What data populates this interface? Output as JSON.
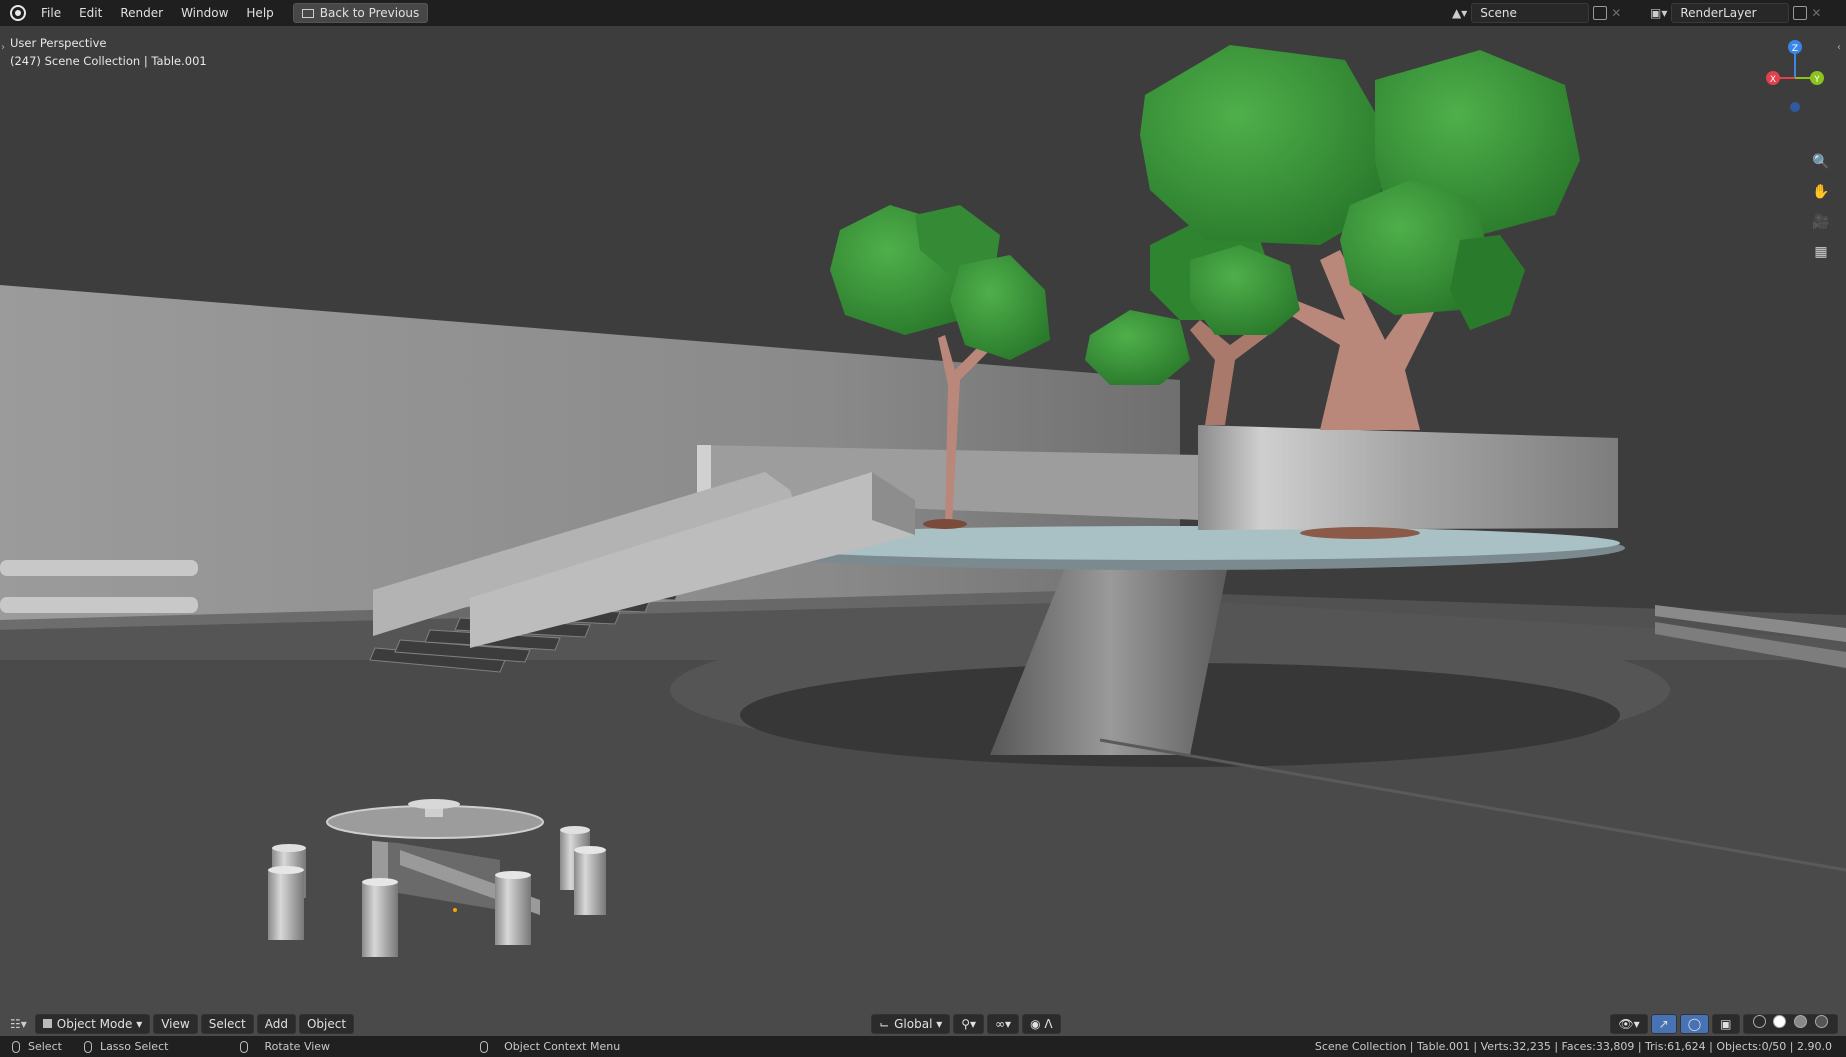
{
  "menu": {
    "items": [
      "File",
      "Edit",
      "Render",
      "Window",
      "Help"
    ],
    "back_button": "Back to Previous"
  },
  "scene": {
    "scene_name": "Scene",
    "layer_name": "RenderLayer"
  },
  "viewport": {
    "perspective_label": "User Perspective",
    "collection_label": "(247) Scene Collection | Table.001",
    "gizmo": {
      "x_label": "X",
      "y_label": "Y",
      "z_label": "Z"
    }
  },
  "header": {
    "mode_label": "Object Mode",
    "menu_items": [
      "View",
      "Select",
      "Add",
      "Object"
    ],
    "transform_orientation": "Global"
  },
  "status": {
    "select": "Select",
    "lasso_select": "Lasso Select",
    "rotate_view": "Rotate View",
    "context_menu": "Object Context Menu",
    "stats": "Scene Collection | Table.001 | Verts:32,235 | Faces:33,809 | Tris:61,624 | Objects:0/50 | 2.90.0"
  },
  "colors": {
    "axis_x": "#e0414b",
    "axis_y": "#8bc21c",
    "axis_z": "#3a86e8",
    "foliage": "#3c9a3c",
    "trunk": "#b58b74"
  }
}
